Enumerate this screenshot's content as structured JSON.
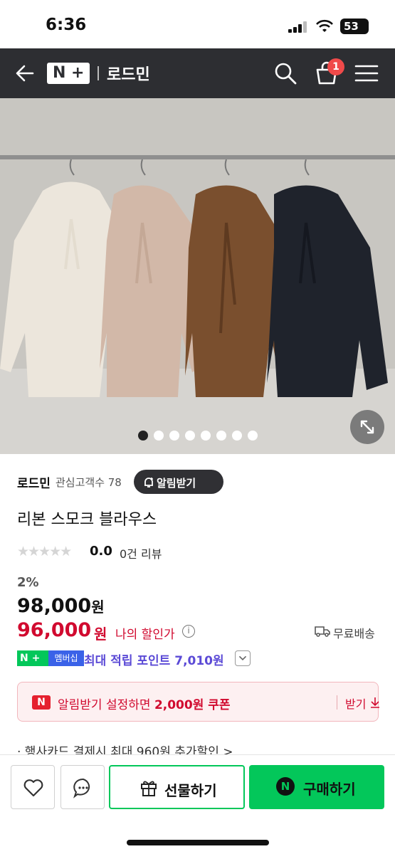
{
  "status": {
    "time": "6:36",
    "battery": "53"
  },
  "nav": {
    "logo_n": "N",
    "logo_plus": "+",
    "store_title": "로드민",
    "cart_count": "1"
  },
  "gallery": {
    "page_count": 8,
    "active_index": 0
  },
  "store": {
    "name": "로드민",
    "fans": "관심고객수 78",
    "alert_label": "알림받기"
  },
  "product": {
    "title": "리본 스모크 블라우스",
    "stars": "★★★★★",
    "rating": "0.0",
    "reviews": "0건 리뷰",
    "discount": "2%",
    "price": "98,000",
    "price_unit": "원",
    "sale_price": "96,000",
    "sale_unit": "원",
    "my_price_label": "나의 할인가",
    "info_icon": "i",
    "shipping": "무료배송"
  },
  "points": {
    "np": "N +",
    "member": "멤버십",
    "text": "최대 적립 포인트 7,010원"
  },
  "coupon": {
    "logo": "N",
    "text_pre": "알림받기 설정하면 ",
    "text_amount": "2,000원 쿠폰",
    "get_label": "받기"
  },
  "card_promo": "· 행사카드 결제시 최대 960원 추가할인 >",
  "bottom": {
    "gift_label": "선물하기",
    "buy_logo": "N",
    "buy_label": "구매하기"
  },
  "colors": {
    "naver_green": "#03c75a",
    "sale_red": "#d10a2f",
    "nav_bg": "#2d2e32",
    "points_purple": "#5b4ad6"
  }
}
